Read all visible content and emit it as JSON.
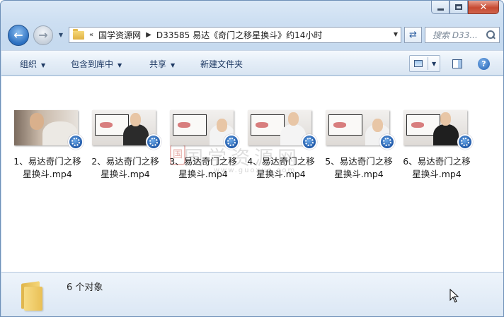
{
  "window": {
    "buttons": {
      "minimize_icon": "minimize-icon",
      "maximize_icon": "maximize-icon",
      "close_glyph": "✕"
    }
  },
  "nav": {
    "address": {
      "overflow": "«",
      "crumbs": [
        "国学资源网",
        "D33585 易达《奇门之移星换斗》约14小时"
      ]
    },
    "search_placeholder": "搜索 D33..."
  },
  "toolbar": {
    "organize": "组织",
    "include_library": "包含到库中",
    "share": "共享",
    "new_folder": "新建文件夹"
  },
  "files": [
    {
      "name_line1": "1、易达奇门之移",
      "name_line2": "星换斗.mp4"
    },
    {
      "name_line1": "2、易达奇门之移",
      "name_line2": "星换斗.mp4"
    },
    {
      "name_line1": "3、易达奇门之移",
      "name_line2": "星换斗.mp4"
    },
    {
      "name_line1": "4、易达奇门之移",
      "name_line2": "星换斗.mp4"
    },
    {
      "name_line1": "5、易达奇门之移",
      "name_line2": "星换斗.mp4"
    },
    {
      "name_line1": "6、易达奇门之移",
      "name_line2": "星换斗.mp4"
    }
  ],
  "watermark": {
    "text": "国学资源网",
    "sub": "www.guoxue.com"
  },
  "details": {
    "count_text": "6 个对象"
  },
  "colors": {
    "accent": "#2b6fc0",
    "toolbar_text": "#1e3963",
    "close_red": "#c74a32"
  }
}
